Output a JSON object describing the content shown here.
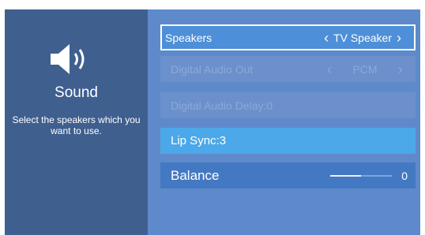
{
  "left": {
    "title": "Sound",
    "description": "Select the speakers which you want to use.",
    "icon": "speaker-volume-icon"
  },
  "rows": [
    {
      "label": "Speakers",
      "value": "TV Speaker",
      "state": "focused"
    },
    {
      "label": "Digital Audio Out",
      "value": "PCM",
      "state": "disabled"
    },
    {
      "label": "Digital Audio Delay:0",
      "state": "disabled"
    },
    {
      "label": "Lip Sync:3",
      "state": "normal"
    },
    {
      "label": "Balance",
      "value": "0",
      "slider_level_percent": 50
    }
  ],
  "colors": {
    "left_panel": "#3f5f8f",
    "right_panel": "#5e8acb",
    "focused_row": "#4d8fd8",
    "active_row": "#4ca8e8",
    "disabled_text": "#8ca9d8"
  }
}
